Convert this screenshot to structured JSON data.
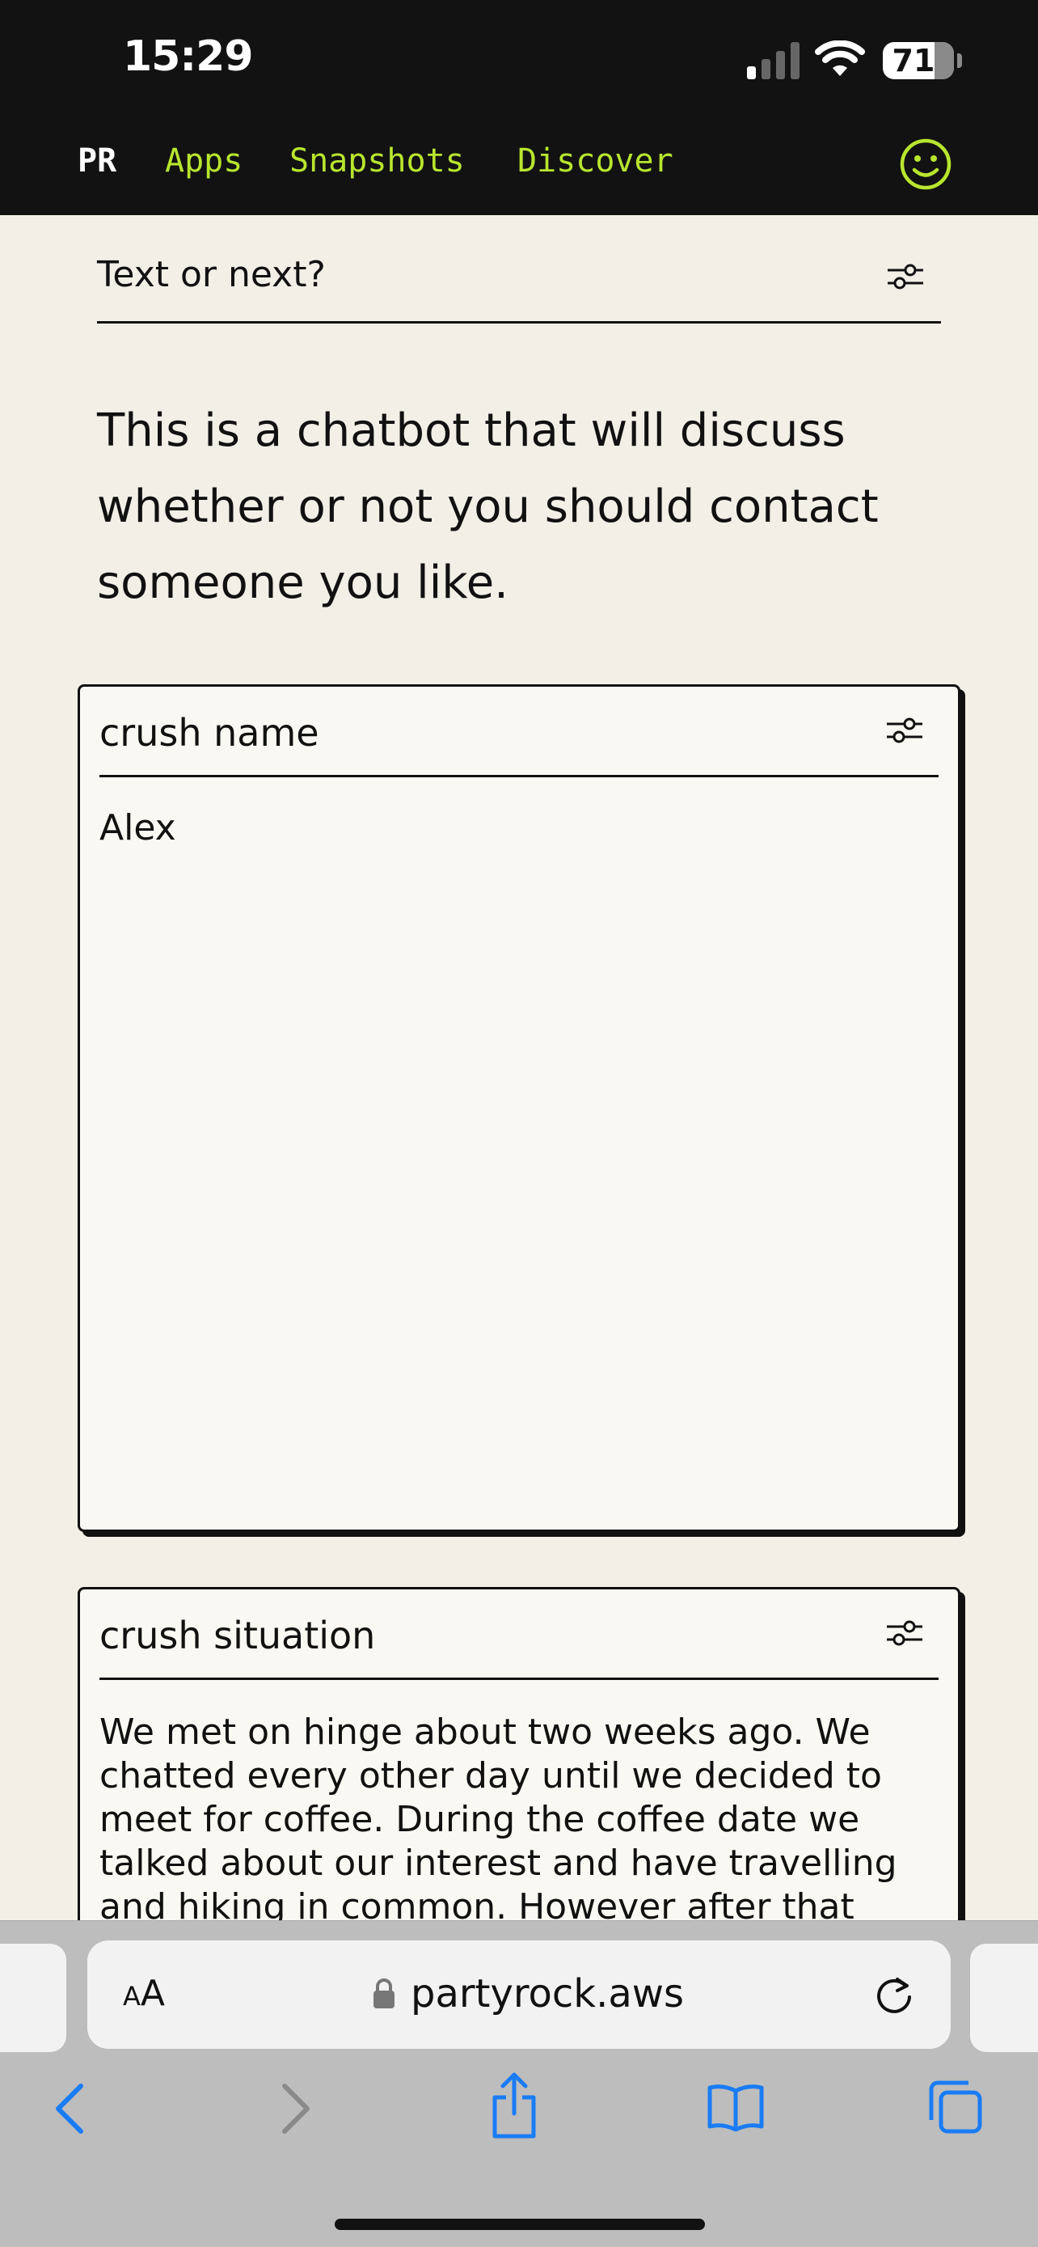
{
  "status_bar": {
    "time": "15:29",
    "battery": "71",
    "icons": [
      "signal-icon",
      "wifi-icon",
      "battery-icon"
    ]
  },
  "nav": {
    "logo": "PR",
    "links": [
      "Apps",
      "Snapshots",
      "Discover"
    ],
    "profile_icon": "smiley-icon",
    "accent_color": "#b8e62e",
    "background_color": "#121212"
  },
  "app": {
    "title": "Text or next?",
    "description": "This is a chatbot that will discuss whether or not you should contact someone you like."
  },
  "widgets": [
    {
      "title": "crush name",
      "value": "Alex"
    },
    {
      "title": "crush situation",
      "value": "We met on hinge about two weeks ago. We chatted every other day until we decided to meet for coffee. During the coffee date we talked about our interest and have travelling and hiking in common. However after that"
    }
  ],
  "browser": {
    "text_size_label_small": "A",
    "text_size_label_large": "A",
    "url": "partyrock.aws",
    "toolbar_icons": [
      "back-icon",
      "forward-icon",
      "share-icon",
      "bookmarks-icon",
      "tabs-icon"
    ]
  },
  "colors": {
    "page_background": "#f2f0e6",
    "card_background": "#f9f8f2",
    "browser_chrome": "#bdbdbd",
    "ios_blue": "#1a7cf5"
  }
}
